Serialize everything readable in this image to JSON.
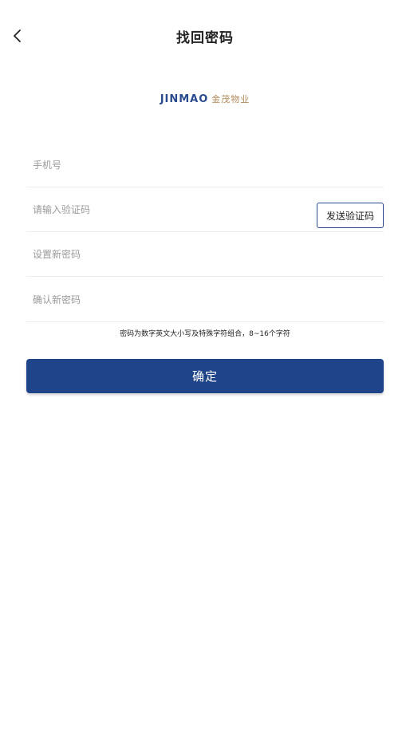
{
  "header": {
    "title": "找回密码",
    "back_icon": "chevron-left-icon"
  },
  "logo": {
    "brand_en": "JINMAO",
    "brand_cn": "金茂物业"
  },
  "form": {
    "phone_placeholder": "手机号",
    "code_placeholder": "请输入验证码",
    "send_code_label": "发送验证码",
    "new_password_placeholder": "设置新密码",
    "confirm_password_placeholder": "确认新密码",
    "password_hint": "密码为数字英文大小写及特殊字符组合，8~16个字符",
    "confirm_label": "确定"
  },
  "colors": {
    "primary": "#1f4489",
    "logo_blue": "#2a4a8e",
    "logo_gold": "#b08a5a"
  }
}
